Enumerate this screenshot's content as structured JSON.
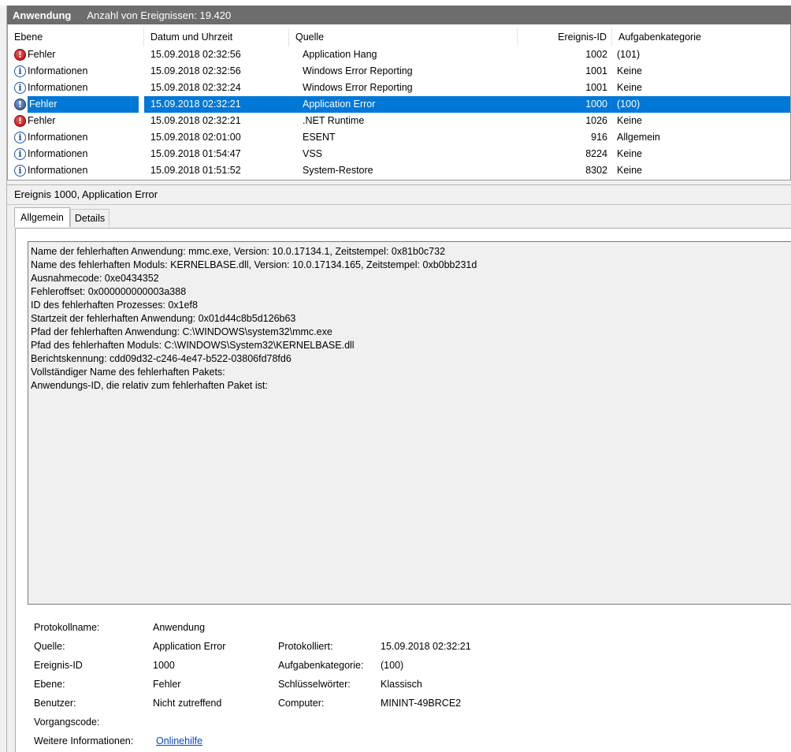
{
  "header": {
    "app": "Anwendung",
    "count_text": "Anzahl von Ereignissen: 19.420"
  },
  "columns": [
    "Ebene",
    "Datum und Uhrzeit",
    "Quelle",
    "Ereignis-ID",
    "Aufgabenkategorie"
  ],
  "events": [
    {
      "icon": "error-icon",
      "level": "Fehler",
      "datetime": "15.09.2018 02:32:56",
      "source": "Application Hang",
      "id": "1002",
      "category": "(101)"
    },
    {
      "icon": "info-icon",
      "level": "Informationen",
      "datetime": "15.09.2018 02:32:56",
      "source": "Windows Error Reporting",
      "id": "1001",
      "category": "Keine"
    },
    {
      "icon": "info-icon",
      "level": "Informationen",
      "datetime": "15.09.2018 02:32:24",
      "source": "Windows Error Reporting",
      "id": "1001",
      "category": "Keine"
    },
    {
      "icon": "error-icon",
      "level": "Fehler",
      "datetime": "15.09.2018 02:32:21",
      "source": "Application Error",
      "id": "1000",
      "category": "(100)",
      "selected": true
    },
    {
      "icon": "error-icon",
      "level": "Fehler",
      "datetime": "15.09.2018 02:32:21",
      "source": ".NET Runtime",
      "id": "1026",
      "category": "Keine"
    },
    {
      "icon": "info-icon",
      "level": "Informationen",
      "datetime": "15.09.2018 02:01:00",
      "source": "ESENT",
      "id": "916",
      "category": "Allgemein"
    },
    {
      "icon": "info-icon",
      "level": "Informationen",
      "datetime": "15.09.2018 01:54:47",
      "source": "VSS",
      "id": "8224",
      "category": "Keine"
    },
    {
      "icon": "info-icon",
      "level": "Informationen",
      "datetime": "15.09.2018 01:51:52",
      "source": "System-Restore",
      "id": "8302",
      "category": "Keine"
    }
  ],
  "detail": {
    "title": "Ereignis 1000, Application Error",
    "tabs": [
      "Allgemein",
      "Details"
    ],
    "description": [
      "Name der fehlerhaften Anwendung: mmc.exe, Version: 10.0.17134.1, Zeitstempel: 0x81b0c732",
      "Name des fehlerhaften Moduls: KERNELBASE.dll, Version: 10.0.17134.165, Zeitstempel: 0xb0bb231d",
      "Ausnahmecode: 0xe0434352",
      "Fehleroffset: 0x000000000003a388",
      "ID des fehlerhaften Prozesses: 0x1ef8",
      "Startzeit der fehlerhaften Anwendung: 0x01d44c8b5d126b63",
      "Pfad der fehlerhaften Anwendung: C:\\WINDOWS\\system32\\mmc.exe",
      "Pfad des fehlerhaften Moduls: C:\\WINDOWS\\System32\\KERNELBASE.dll",
      "Berichtskennung: cdd09d32-c246-4e47-b522-03806fd78fd6",
      "Vollständiger Name des fehlerhaften Pakets:",
      "Anwendungs-ID, die relativ zum fehlerhaften Paket ist:"
    ],
    "props": {
      "protokollname_label": "Protokollname:",
      "protokollname": "Anwendung",
      "quelle_label": "Quelle:",
      "quelle": "Application Error",
      "protokolliert_label": "Protokolliert:",
      "protokolliert": "15.09.2018 02:32:21",
      "ereignis_label": "Ereignis-ID",
      "ereignis": "1000",
      "kategorie_label": "Aufgabenkategorie:",
      "kategorie": "(100)",
      "ebene_label": "Ebene:",
      "ebene": "Fehler",
      "schluessel_label": "Schlüsselwörter:",
      "schluessel": "Klassisch",
      "benutzer_label": "Benutzer:",
      "benutzer": "Nicht zutreffend",
      "computer_label": "Computer:",
      "computer": "MININT-49BRCE2",
      "vorgang_label": "Vorgangscode:",
      "weitere_label": "Weitere Informationen:",
      "weitere_link": "Onlinehilfe"
    }
  }
}
